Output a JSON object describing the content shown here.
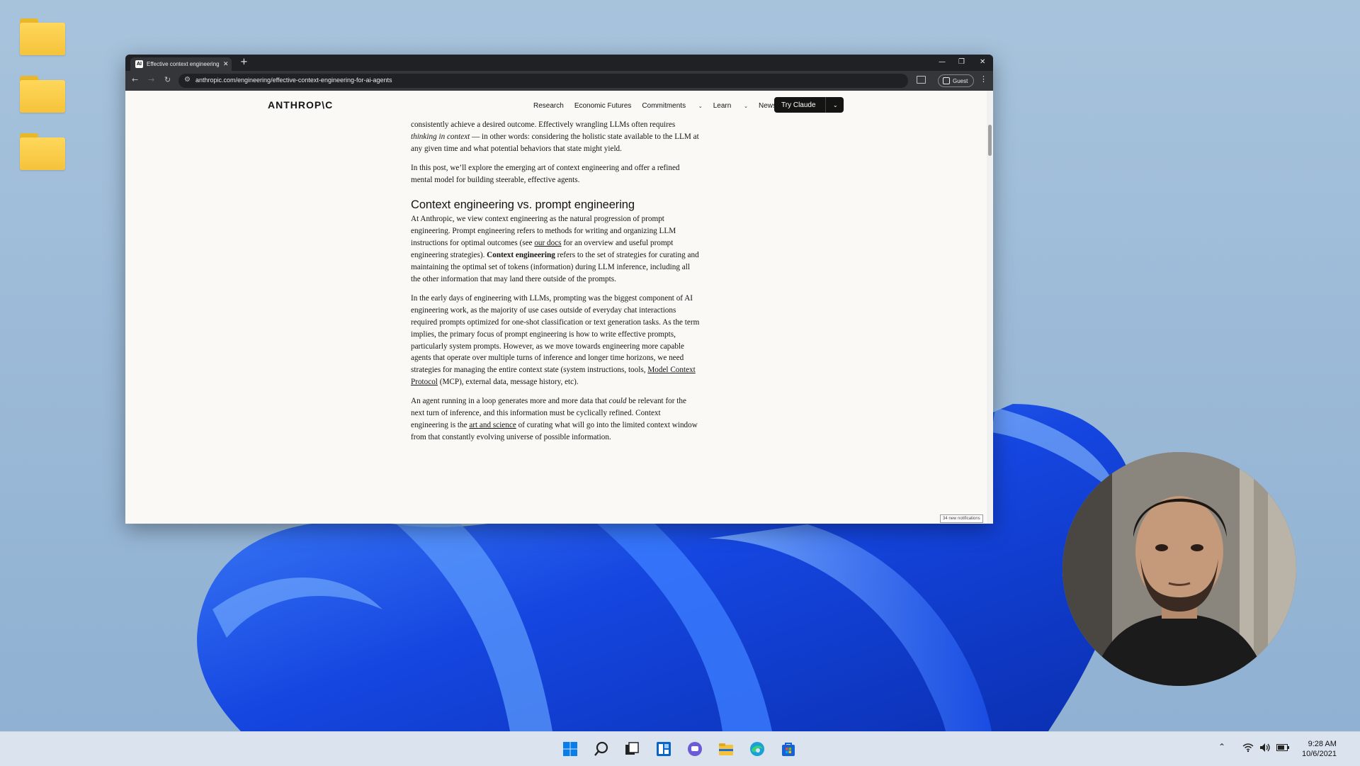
{
  "desktop": {
    "icons": [
      "folder-icon",
      "folder-icon",
      "folder-icon"
    ]
  },
  "browser": {
    "tab": {
      "favicon": "AI",
      "title": "Effective context engineering f",
      "close": "✕"
    },
    "new_tab": "+",
    "window_controls": {
      "minimize": "—",
      "restore": "❐",
      "close": "✕"
    },
    "url": "anthropic.com/engineering/effective-context-engineering-for-ai-agents",
    "profile_label": "Guest"
  },
  "site": {
    "logo": "ANTHROP\\C",
    "nav": {
      "research": "Research",
      "economic_futures": "Economic Futures",
      "commitments": "Commitments",
      "learn": "Learn",
      "news": "News"
    },
    "cta": "Try Claude"
  },
  "article": {
    "p1": {
      "a": "consistently achieve a desired outcome. Effectively wrangling LLMs often requires ",
      "em": "thinking in context",
      "b": " — in other words: considering the holistic state available to the LLM at any given time and what potential behaviors that state might yield."
    },
    "p2": "In this post, we’ll explore the emerging art of context engineering and offer a refined mental model for building steerable, effective agents.",
    "heading": "Context engineering vs. prompt engineering",
    "p3": {
      "a": "At Anthropic, we view context engineering as the natural progression of prompt engineering. Prompt engineering refers to methods for writing and organizing LLM instructions for optimal outcomes (see ",
      "link": "our docs",
      "b": " for an overview and useful prompt engineering strategies). ",
      "strong": "Context engineering",
      "c": " refers to the set of strategies for curating and maintaining the optimal set of tokens (information) during LLM inference, including all the other information that may land there outside of the prompts."
    },
    "p4": {
      "a": "In the early days of engineering with LLMs, prompting was the biggest component of AI engineering work, as the majority of use cases outside of everyday chat interactions required prompts optimized for one-shot classification or text generation tasks. As the term implies, the primary focus of prompt engineering is how to write effective prompts, particularly system prompts. However, as we move towards engineering more capable agents that operate over multiple turns of inference and longer time horizons, we need strategies for managing the entire context state (system instructions, tools, ",
      "link": "Model Context Protocol",
      "b": " (MCP), external data, message history, etc)."
    },
    "p5": {
      "a": "An agent running in a loop generates more and more data that ",
      "em": "could",
      "b": " be relevant for the next turn of inference, and this information must be cyclically refined. Context engineering is the ",
      "link": "art and science",
      "c": " of curating what will go into the limited context window from that constantly evolving universe of possible information."
    }
  },
  "notification": "34 new notifications",
  "taskbar": {
    "apps": [
      "windows-start-icon",
      "search-icon",
      "task-view-icon",
      "widgets-icon",
      "chat-icon",
      "file-explorer-icon",
      "edge-icon",
      "store-icon"
    ],
    "tray": [
      "chevron-up-icon",
      "wifi-icon",
      "volume-icon",
      "battery-icon"
    ],
    "time": "9:28 AM",
    "date": "10/6/2021"
  },
  "colors": {
    "page_bg": "#faf9f5",
    "text": "#141413",
    "chrome_dark": "#202124",
    "chrome_toolbar": "#35363a",
    "wallpaper_blue": "#1a5bff"
  }
}
